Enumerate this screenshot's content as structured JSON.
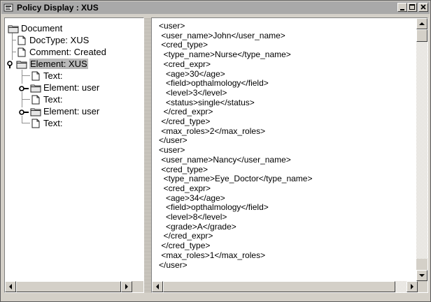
{
  "window": {
    "title": "Policy Display : XUS",
    "controls": [
      "minimize-icon",
      "maximize-icon",
      "close-icon"
    ]
  },
  "tree": {
    "nodes": [
      {
        "label": "Document",
        "icon": "folder-icon"
      },
      {
        "label": "DocType: XUS",
        "icon": "file-icon"
      },
      {
        "label": "Comment: Created",
        "icon": "file-icon"
      },
      {
        "label": "Element: XUS",
        "icon": "folder-icon",
        "selected": true,
        "handle": "expanded"
      },
      {
        "label": "Text:",
        "icon": "file-icon"
      },
      {
        "label": "Element: user",
        "icon": "folder-icon",
        "handle": "collapsed"
      },
      {
        "label": "Text:",
        "icon": "file-icon"
      },
      {
        "label": "Element: user",
        "icon": "folder-icon",
        "handle": "collapsed"
      },
      {
        "label": "Text:",
        "icon": "file-icon"
      }
    ]
  },
  "xml": {
    "lines": [
      "<user>",
      " <user_name>John</user_name>",
      " <cred_type>",
      "  <type_name>Nurse</type_name>",
      "  <cred_expr>",
      "   <age>30</age>",
      "   <field>opthalmology</field>",
      "   <level>3</level>",
      "   <status>single</status>",
      "  </cred_expr>",
      " </cred_type>",
      " <max_roles>2</max_roles>",
      "</user>",
      "<user>",
      " <user_name>Nancy</user_name>",
      " <cred_type>",
      "  <type_name>Eye_Doctor</type_name>",
      "  <cred_expr>",
      "   <age>34</age>",
      "   <field>opthalmology</field>",
      "   <level>8</level>",
      "   <grade>A</grade>",
      "  </cred_expr>",
      " </cred_type>",
      " <max_roles>1</max_roles>",
      "</user>"
    ]
  }
}
